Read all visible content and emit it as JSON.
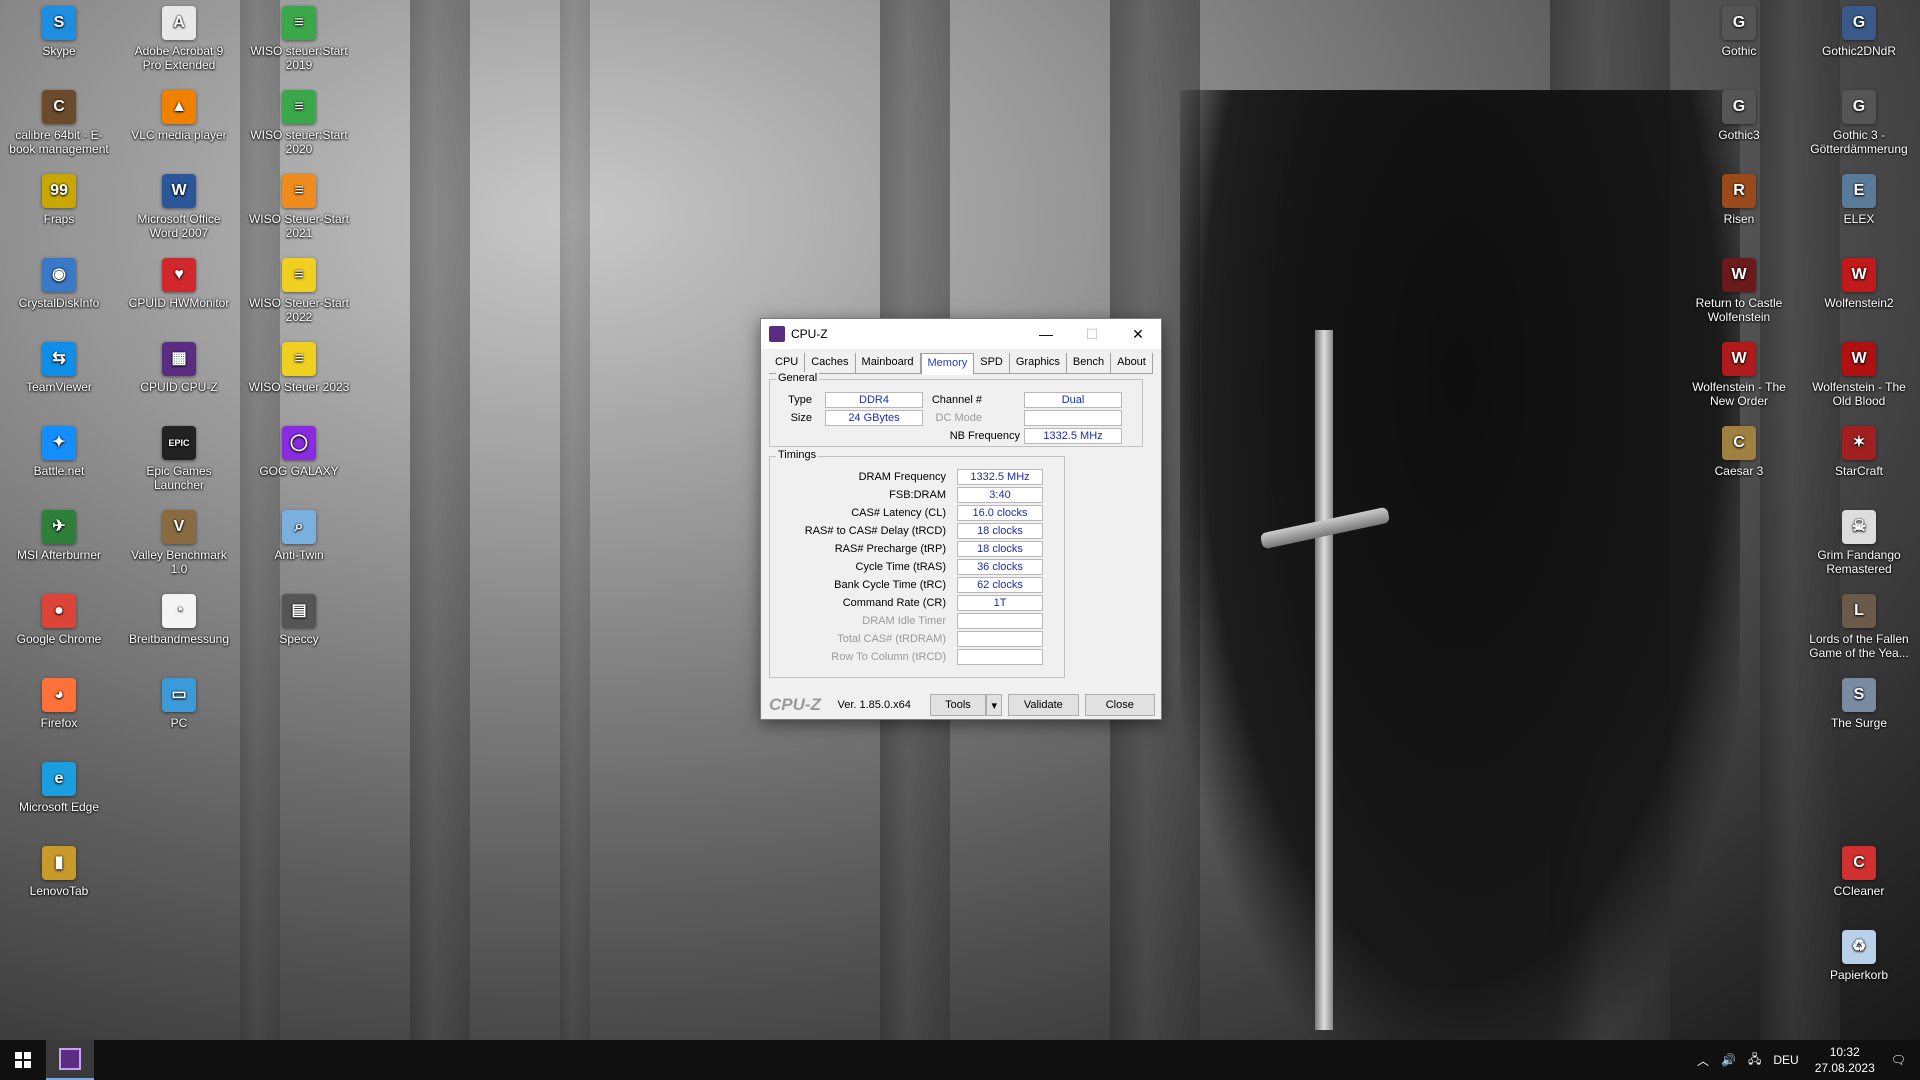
{
  "desktop": {
    "icons_left": [
      {
        "label": "Skype",
        "icon": "skype-icon",
        "color": "#1e8fe0",
        "glyph": "S"
      },
      {
        "label": "calibre 64bit - E-book management",
        "icon": "calibre-icon",
        "color": "#6b4b2b",
        "glyph": "C"
      },
      {
        "label": "Fraps",
        "icon": "fraps-icon",
        "color": "#c8a800",
        "glyph": "99"
      },
      {
        "label": "CrystalDiskInfo",
        "icon": "crystaldiskinfo-icon",
        "color": "#3a78c8",
        "glyph": "◉"
      },
      {
        "label": "TeamViewer",
        "icon": "teamviewer-icon",
        "color": "#0e8ee9",
        "glyph": "⇆"
      },
      {
        "label": "Battle.net",
        "icon": "battlenet-icon",
        "color": "#148eff",
        "glyph": "✦"
      },
      {
        "label": "MSI Afterburner",
        "icon": "msi-afterburner-icon",
        "color": "#2d7f3a",
        "glyph": "✈"
      },
      {
        "label": "Google Chrome",
        "icon": "chrome-icon",
        "color": "#db4437",
        "glyph": "●"
      },
      {
        "label": "Firefox",
        "icon": "firefox-icon",
        "color": "#ff7139",
        "glyph": "◕"
      },
      {
        "label": "Microsoft Edge",
        "icon": "edge-icon",
        "color": "#1a9ee0",
        "glyph": "e"
      },
      {
        "label": "LenovoTab",
        "icon": "lenovotab-icon",
        "color": "#c89a2a",
        "glyph": "▮"
      }
    ],
    "icons_col2": [
      {
        "label": "Adobe Acrobat 9 Pro Extended",
        "icon": "acrobat-icon",
        "color": "#e8e8e8",
        "glyph": "A"
      },
      {
        "label": "VLC media player",
        "icon": "vlc-icon",
        "color": "#f08000",
        "glyph": "▲"
      },
      {
        "label": "Microsoft Office Word 2007",
        "icon": "word-icon",
        "color": "#2b579a",
        "glyph": "W"
      },
      {
        "label": "CPUID HWMonitor",
        "icon": "hwmonitor-icon",
        "color": "#d0282c",
        "glyph": "♥"
      },
      {
        "label": "CPUID CPU-Z",
        "icon": "cpuz-icon",
        "color": "#5a2d82",
        "glyph": "▦"
      },
      {
        "label": "Epic Games Launcher",
        "icon": "epic-games-icon",
        "color": "#222",
        "glyph": "EPIC"
      },
      {
        "label": "Valley Benchmark 1.0",
        "icon": "valley-benchmark-icon",
        "color": "#8a6a40",
        "glyph": "V"
      },
      {
        "label": "Breitbandmessung",
        "icon": "breitbandmessung-icon",
        "color": "#f4f4f4",
        "glyph": "◔"
      },
      {
        "label": "PC",
        "icon": "pc-icon",
        "color": "#3c9ad8",
        "glyph": "▭"
      }
    ],
    "icons_col3": [
      {
        "label": "WISO steuer:Start 2019",
        "icon": "wiso-2019-icon",
        "color": "#3aa84a",
        "glyph": "≡"
      },
      {
        "label": "WISO steuer:Start 2020",
        "icon": "wiso-2020-icon",
        "color": "#3aa84a",
        "glyph": "≡"
      },
      {
        "label": "WISO Steuer-Start 2021",
        "icon": "wiso-2021-icon",
        "color": "#f08c1e",
        "glyph": "≡"
      },
      {
        "label": "WISO Steuer-Start 2022",
        "icon": "wiso-2022-icon",
        "color": "#f0d01e",
        "glyph": "≡"
      },
      {
        "label": "WISO Steuer 2023",
        "icon": "wiso-2023-icon",
        "color": "#f0d01e",
        "glyph": "≡"
      },
      {
        "label": "GOG GALAXY",
        "icon": "gog-galaxy-icon",
        "color": "#8a2be2",
        "glyph": "◯"
      },
      {
        "label": "Anti-Twin",
        "icon": "anti-twin-icon",
        "color": "#7ab0e0",
        "glyph": "⌕"
      },
      {
        "label": "Speccy",
        "icon": "speccy-icon",
        "color": "#555",
        "glyph": "▤"
      }
    ],
    "icons_right1": [
      {
        "label": "Gothic",
        "icon": "gothic-icon",
        "color": "#555",
        "glyph": "G"
      },
      {
        "label": "Gothic3",
        "icon": "gothic3-icon",
        "color": "#555",
        "glyph": "G"
      },
      {
        "label": "Risen",
        "icon": "risen-icon",
        "color": "#9a4a1a",
        "glyph": "R"
      },
      {
        "label": "Return to Castle Wolfenstein",
        "icon": "rtcw-icon",
        "color": "#6a1a1a",
        "glyph": "W"
      },
      {
        "label": "Wolfenstein - The New Order",
        "icon": "wolfenstein-new-order-icon",
        "color": "#b01a1a",
        "glyph": "W"
      },
      {
        "label": "Caesar 3",
        "icon": "caesar3-icon",
        "color": "#a08040",
        "glyph": "C"
      }
    ],
    "icons_right2": [
      {
        "label": "Gothic2DNdR",
        "icon": "gothic2-icon",
        "color": "#3a5a8a",
        "glyph": "G"
      },
      {
        "label": "Gothic 3 - Götterdämmerung",
        "icon": "gothic3-gd-icon",
        "color": "#555",
        "glyph": "G"
      },
      {
        "label": "ELEX",
        "icon": "elex-icon",
        "color": "#5a7a9a",
        "glyph": "E"
      },
      {
        "label": "Wolfenstein2",
        "icon": "wolfenstein2-icon",
        "color": "#c01a1a",
        "glyph": "W"
      },
      {
        "label": "Wolfenstein - The Old Blood",
        "icon": "wolfenstein-old-blood-icon",
        "color": "#b01010",
        "glyph": "W"
      },
      {
        "label": "StarCraft",
        "icon": "starcraft-icon",
        "color": "#a02020",
        "glyph": "✶"
      },
      {
        "label": "Grim Fandango Remastered",
        "icon": "grim-fandango-icon",
        "color": "#ddd",
        "glyph": "☠"
      },
      {
        "label": "Lords of the Fallen Game of the Yea...",
        "icon": "lords-fallen-icon",
        "color": "#6a5a4a",
        "glyph": "L"
      },
      {
        "label": "The Surge",
        "icon": "the-surge-icon",
        "color": "#7a8aa0",
        "glyph": "S"
      },
      {
        "label": "CCleaner",
        "icon": "ccleaner-icon",
        "color": "#d03030",
        "glyph": "C"
      },
      {
        "label": "Papierkorb",
        "icon": "recycle-bin-icon",
        "color": "#b8d0e8",
        "glyph": "♻"
      }
    ]
  },
  "cpuz": {
    "title": "CPU-Z",
    "tabs": [
      "CPU",
      "Caches",
      "Mainboard",
      "Memory",
      "SPD",
      "Graphics",
      "Bench",
      "About"
    ],
    "active_tab": "Memory",
    "general": {
      "label": "General",
      "type_label": "Type",
      "type": "DDR4",
      "size_label": "Size",
      "size": "24 GBytes",
      "channel_label": "Channel #",
      "channel": "Dual",
      "dcmode_label": "DC Mode",
      "dcmode": "",
      "nbfreq_label": "NB Frequency",
      "nbfreq": "1332.5 MHz"
    },
    "timings": {
      "label": "Timings",
      "rows": [
        {
          "label": "DRAM Frequency",
          "value": "1332.5 MHz",
          "dim": false
        },
        {
          "label": "FSB:DRAM",
          "value": "3:40",
          "dim": false
        },
        {
          "label": "CAS# Latency (CL)",
          "value": "16.0 clocks",
          "dim": false
        },
        {
          "label": "RAS# to CAS# Delay (tRCD)",
          "value": "18 clocks",
          "dim": false
        },
        {
          "label": "RAS# Precharge (tRP)",
          "value": "18 clocks",
          "dim": false
        },
        {
          "label": "Cycle Time (tRAS)",
          "value": "36 clocks",
          "dim": false
        },
        {
          "label": "Bank Cycle Time (tRC)",
          "value": "62 clocks",
          "dim": false
        },
        {
          "label": "Command Rate (CR)",
          "value": "1T",
          "dim": false
        },
        {
          "label": "DRAM Idle Timer",
          "value": "",
          "dim": true
        },
        {
          "label": "Total CAS# (tRDRAM)",
          "value": "",
          "dim": true
        },
        {
          "label": "Row To Column (tRCD)",
          "value": "",
          "dim": true
        }
      ]
    },
    "footer": {
      "brand": "CPU-Z",
      "version": "Ver. 1.85.0.x64",
      "tools": "Tools",
      "validate": "Validate",
      "close": "Close"
    }
  },
  "taskbar": {
    "language": "DEU",
    "time": "10:32",
    "date": "27.08.2023"
  }
}
